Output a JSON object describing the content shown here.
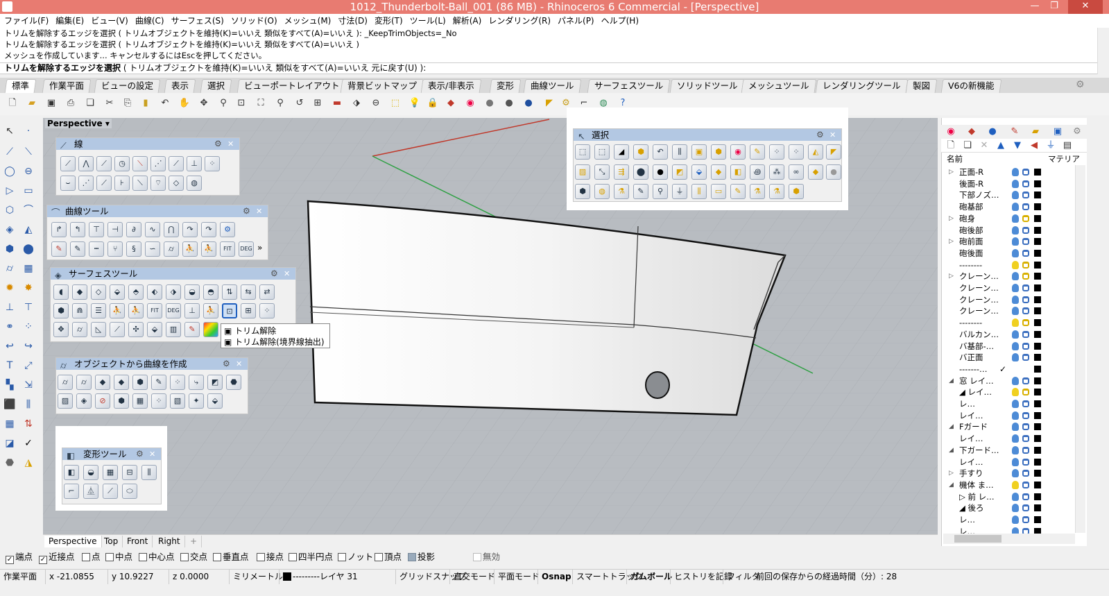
{
  "window": {
    "title": "1012_Thunderbolt-Ball_001 (86 MB) - Rhinoceros 6 Commercial - [Perspective]",
    "controls": [
      "—",
      "❐",
      "✕"
    ]
  },
  "menu": [
    "ファイル(F)",
    "編集(E)",
    "ビュー(V)",
    "曲線(C)",
    "サーフェス(S)",
    "ソリッド(O)",
    "メッシュ(M)",
    "寸法(D)",
    "変形(T)",
    "ツール(L)",
    "解析(A)",
    "レンダリング(R)",
    "パネル(P)",
    "ヘルプ(H)"
  ],
  "command": {
    "history": [
      "トリムを解除するエッジを選択 ( トリムオブジェクトを維持(K)=いいえ  類似をすべて(A)=いいえ ): _KeepTrimObjects=_No",
      "トリムを解除するエッジを選択 ( トリムオブジェクトを維持(K)=いいえ  類似をすべて(A)=いいえ )",
      "メッシュを作成しています... キャンセルするにはEscを押してください。"
    ],
    "prompt_bold": "トリムを解除するエッジを選択",
    "prompt_rest": " ( トリムオブジェクトを維持(K)=いいえ  類似をすべて(A)=いいえ  元に戻す(U) ):"
  },
  "toolbar_tabs": [
    "標準",
    "作業平面",
    "ビューの設定",
    "表示",
    "選択",
    "ビューポートレイアウト",
    "背景ビットマップ",
    "表示/非表示",
    "変形",
    "曲線ツール",
    "サーフェスツール",
    "ソリッドツール",
    "メッシュツール",
    "レンダリングツール",
    "製図",
    "V6の新機能"
  ],
  "viewport": {
    "label": "Perspective",
    "tabs": [
      "Perspective",
      "Top",
      "Front",
      "Right"
    ],
    "add_tab": "+"
  },
  "panels": {
    "line": "線",
    "curve_tools": "曲線ツール",
    "surface_tools": "サーフェスツール",
    "curve_from_objects": "オブジェクトから曲線を作成",
    "transform_tools": "変形ツール",
    "select": "選択"
  },
  "icon_text": {
    "fit": "FIT",
    "deg": "DEG",
    "more": "»"
  },
  "tooltip": {
    "line1": "トリム解除",
    "line2": "トリム解除(境界線抽出)"
  },
  "layers": {
    "header_name": "名前",
    "header_material": "マテリア",
    "rows": [
      {
        "exp": "▷",
        "name": "正面-R",
        "bulb": "b"
      },
      {
        "exp": "",
        "name": "後面-R",
        "bulb": "b"
      },
      {
        "exp": "",
        "name": "下部ノズ…",
        "bulb": "b"
      },
      {
        "exp": "",
        "name": "砲基部",
        "bulb": "b"
      },
      {
        "exp": "▷",
        "name": "砲身",
        "bulb": "b",
        "lock": "y"
      },
      {
        "exp": "",
        "name": "砲後部",
        "bulb": "b"
      },
      {
        "exp": "▷",
        "name": "砲前面",
        "bulb": "b"
      },
      {
        "exp": "",
        "name": "砲後面",
        "bulb": "b"
      },
      {
        "exp": "",
        "name": "--------",
        "bulb": "y",
        "lock": "y"
      },
      {
        "exp": "▷",
        "name": "クレーン…",
        "bulb": "b",
        "lock": "y"
      },
      {
        "exp": "",
        "name": "クレーン…",
        "bulb": "b"
      },
      {
        "exp": "",
        "name": "クレーン…",
        "bulb": "b"
      },
      {
        "exp": "",
        "name": "クレーン…",
        "bulb": "b"
      },
      {
        "exp": "",
        "name": "--------",
        "bulb": "y",
        "lock": "y"
      },
      {
        "exp": "",
        "name": "バルカン…",
        "bulb": "b"
      },
      {
        "exp": "",
        "name": "バ基部-…",
        "bulb": "b"
      },
      {
        "exp": "",
        "name": "バ正面",
        "bulb": "b"
      },
      {
        "exp": "",
        "name": "-------…",
        "check": "✓"
      },
      {
        "exp": "◢",
        "name": "窓  レイ…",
        "bulb": "b"
      },
      {
        "exp": "",
        "name": "  ◢ レイ…",
        "bulb": "y",
        "lock": "y"
      },
      {
        "exp": "",
        "name": "      レ…",
        "bulb": "b"
      },
      {
        "exp": "",
        "name": "    レイ…",
        "bulb": "b"
      },
      {
        "exp": "◢",
        "name": "Fガード",
        "bulb": "b"
      },
      {
        "exp": "",
        "name": "    レイ…",
        "bulb": "b"
      },
      {
        "exp": "◢",
        "name": "下ガード…",
        "bulb": "b"
      },
      {
        "exp": "",
        "name": "    レイ…",
        "bulb": "b"
      },
      {
        "exp": "▷",
        "name": "手すり",
        "bulb": "b"
      },
      {
        "exp": "◢",
        "name": "機体  ま…",
        "bulb": "y"
      },
      {
        "exp": "",
        "name": "  ▷ 前  レ…",
        "bulb": "b"
      },
      {
        "exp": "",
        "name": "  ◢ 後ろ",
        "bulb": "b"
      },
      {
        "exp": "",
        "name": "      レ…",
        "bulb": "b"
      },
      {
        "exp": "",
        "name": "      レ…",
        "bulb": "b"
      }
    ]
  },
  "osnap": [
    {
      "label": "端点",
      "checked": true
    },
    {
      "label": "近接点",
      "checked": true
    },
    {
      "label": "点",
      "checked": false
    },
    {
      "label": "中点",
      "checked": false
    },
    {
      "label": "中心点",
      "checked": false
    },
    {
      "label": "交点",
      "checked": false
    },
    {
      "label": "垂直点",
      "checked": false
    },
    {
      "label": "接点",
      "checked": false
    },
    {
      "label": "四半円点",
      "checked": false
    },
    {
      "label": "ノット",
      "checked": false
    },
    {
      "label": "頂点",
      "checked": false
    },
    {
      "label": "投影",
      "checked": false
    },
    {
      "label": "無効",
      "checked": false
    }
  ],
  "status": {
    "cplane": "作業平面",
    "x": "x -21.0855",
    "y": "y 10.9227",
    "z": "z 0.0000",
    "units": "ミリメートル",
    "layer": "---------レイヤ 31",
    "grid_snap": "グリッドスナップ",
    "ortho": "直交モード",
    "planar": "平面モード",
    "osnap": "Osnap",
    "smarttrack": "スマートトラック",
    "gumball": "ガムボール",
    "history": "ヒストリを記録",
    "filter": "フィルタ",
    "elapsed": "前回の保存からの経過時間（分）: 28"
  },
  "colors": {
    "titlebar": "#e87b71",
    "panel_header": "#b3c8e3",
    "viewport": "#b8bcc1",
    "x_axis": "#c0392b",
    "y_axis": "#2ea043"
  }
}
